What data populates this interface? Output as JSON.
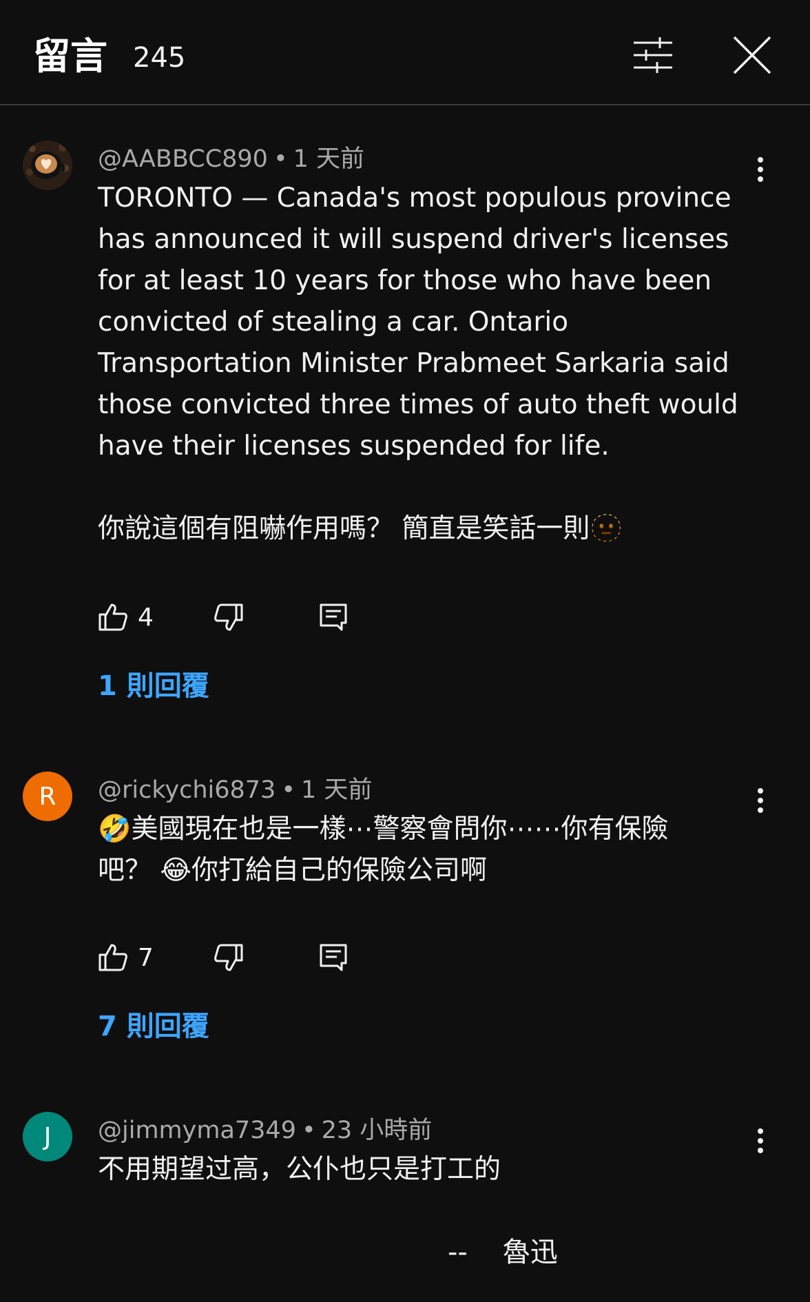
{
  "header": {
    "title": "留言",
    "count": "245"
  },
  "comments": [
    {
      "author": "@AABBCC890",
      "time": "1 天前",
      "avatar_icon": "latte-art-coffee-cup",
      "text": "TORONTO — Canada's most populous province\nhas announced it will suspend driver's licenses\nfor at least 10 years for those who have been\nconvicted of stealing a car. Ontario\nTransportation Minister Prabmeet Sarkaria said\nthose convicted three times of auto theft would\nhave their licenses suspended for life.\n\n你說這個有阻嚇作用嗎？ 簡直是笑話一則🫥",
      "likes": "4",
      "replies": "1 則回覆"
    },
    {
      "author": "@rickychi6873",
      "time": "1 天前",
      "avatar_letter": "R",
      "avatar_color": "#ef6c00",
      "text": "🤣美國現在也是一樣⋯警察會問你⋯⋯你有保險\n吧？ 😂你打給自己的保險公司啊",
      "likes": "7",
      "replies": "7 則回覆"
    },
    {
      "author": "@jimmyma7349",
      "time": "23 小時前",
      "avatar_letter": "J",
      "avatar_color": "#00897b",
      "text": "不用期望过高，公仆也只是打工的"
    }
  ],
  "footer_text": "--    魯迅",
  "colors": {
    "background": "#0f0f0f",
    "link": "#3ea6ff",
    "secondary_text": "#aaaaaa"
  }
}
